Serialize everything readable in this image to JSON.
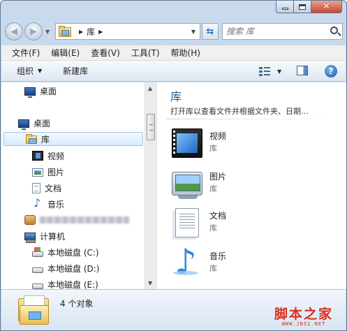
{
  "window": {
    "caption_buttons": {
      "minimize": "—",
      "maximize": "□",
      "close": "✕"
    }
  },
  "address_bar": {
    "crumbs": [
      "库"
    ],
    "search_placeholder": "搜索 库"
  },
  "menu": [
    "文件(F)",
    "编辑(E)",
    "查看(V)",
    "工具(T)",
    "帮助(H)"
  ],
  "command_bar": {
    "organize": "组织",
    "new_library": "新建库"
  },
  "nav_pane": {
    "items": [
      {
        "label": "桌面",
        "icon": "desktop-icon"
      },
      {
        "label": "桌面",
        "icon": "desktop-icon"
      },
      {
        "label": "库",
        "icon": "library-folder-icon",
        "selected": true
      },
      {
        "label": "视频",
        "icon": "video-icon"
      },
      {
        "label": "图片",
        "icon": "picture-icon"
      },
      {
        "label": "文档",
        "icon": "document-icon"
      },
      {
        "label": "音乐",
        "icon": "music-icon"
      },
      {
        "label": "",
        "icon": "user-folder-icon"
      },
      {
        "label": "计算机",
        "icon": "computer-icon"
      },
      {
        "label": "本地磁盘 (C:)",
        "icon": "drive-c-icon"
      },
      {
        "label": "本地磁盘 (D:)",
        "icon": "drive-icon"
      },
      {
        "label": "本地磁盘 (E:)",
        "icon": "drive-icon"
      }
    ]
  },
  "content": {
    "title": "库",
    "subtitle": "打开库以查看文件并根据文件夹、日期…",
    "libraries": [
      {
        "name": "视频",
        "kind": "库",
        "icon": "video-library-icon"
      },
      {
        "name": "图片",
        "kind": "库",
        "icon": "picture-library-icon"
      },
      {
        "name": "文档",
        "kind": "库",
        "icon": "document-library-icon"
      },
      {
        "name": "音乐",
        "kind": "库",
        "icon": "music-library-icon"
      }
    ]
  },
  "status_bar": {
    "count_text": "4 个对象"
  },
  "watermark": {
    "title": "脚本之家",
    "url": "WWW.JB51.NET"
  },
  "colors": {
    "title_accent": "#1e5a8e",
    "watermark": "#d8301f",
    "selection_border": "#9cc4ea"
  }
}
